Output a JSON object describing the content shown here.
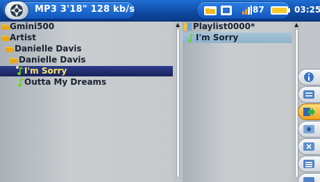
{
  "status_bar": {
    "track_info": "MP3 3'18\" 128 kb/s",
    "volume": "87",
    "clock": "03:25"
  },
  "browser": {
    "items": [
      {
        "label": "Gmini500",
        "icon": "folder-icon"
      },
      {
        "label": "Artist",
        "icon": "folder-icon"
      },
      {
        "label": "Danielle Davis",
        "icon": "folder-icon"
      },
      {
        "label": "Danielle Davis",
        "icon": "folder-icon"
      },
      {
        "label": "I'm Sorry",
        "icon": "music-note-icon",
        "selected": true
      },
      {
        "label": "Outta My Dreams",
        "icon": "music-note-icon"
      }
    ]
  },
  "playlist": {
    "title": "Playlist0000*",
    "items": [
      {
        "label": "I'm Sorry",
        "icon": "music-note-icon",
        "selected": true
      }
    ]
  },
  "side_buttons": [
    "info-icon",
    "add-to-playlist-icon",
    "move-icon",
    "edit-icon",
    "delete-icon",
    "playlist-menu-icon"
  ],
  "colors": {
    "status_blue": "#1257bd",
    "highlight_dark": "#18225a",
    "highlight_text": "#ffe66b",
    "folder_yellow": "#f4c22a",
    "note_green": "#6fcf2a",
    "active_button": "#f0a020"
  }
}
